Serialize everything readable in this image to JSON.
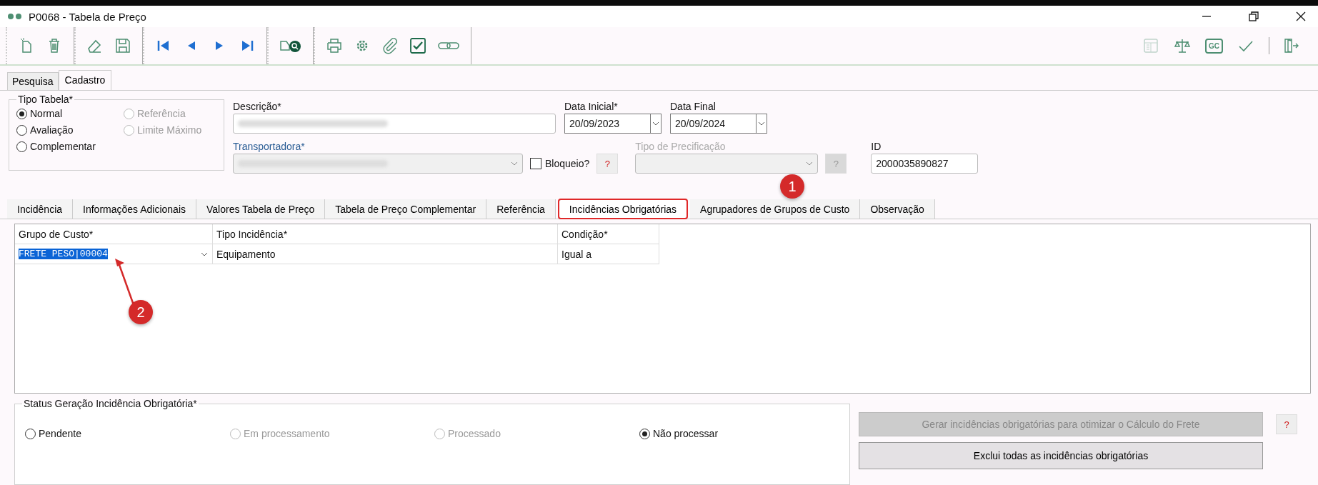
{
  "window": {
    "title": "P0068 - Tabela de Preço"
  },
  "toolbar": {
    "left_groups": [
      [
        {
          "kind": "new"
        },
        {
          "kind": "delete"
        }
      ],
      [
        {
          "kind": "edit"
        },
        {
          "kind": "save"
        }
      ],
      [
        {
          "kind": "first"
        },
        {
          "kind": "prev"
        },
        {
          "kind": "next"
        },
        {
          "kind": "last"
        }
      ],
      [
        {
          "kind": "search-truck"
        }
      ],
      [
        {
          "kind": "print"
        },
        {
          "kind": "gear"
        },
        {
          "kind": "clip"
        },
        {
          "kind": "check-box"
        },
        {
          "kind": "link"
        }
      ]
    ],
    "right": [
      {
        "kind": "sheet",
        "disabled": true
      },
      {
        "kind": "scale",
        "disabled": false
      },
      {
        "kind": "gc",
        "disabled": false
      },
      {
        "kind": "confirm",
        "disabled": false
      },
      {
        "kind": "exit",
        "disabled": false
      }
    ]
  },
  "gc_label": "GC",
  "main_tabs": [
    {
      "label": "Pesquisa",
      "selected": false
    },
    {
      "label": "Cadastro",
      "selected": true
    }
  ],
  "tipo_tabela": {
    "legend": "Tipo Tabela*",
    "options": [
      {
        "label": "Normal",
        "selected": true,
        "disabled": false
      },
      {
        "label": "Referência",
        "selected": false,
        "disabled": true
      },
      {
        "label": "Avaliação",
        "selected": false,
        "disabled": false
      },
      {
        "label": "Limite Máximo",
        "selected": false,
        "disabled": true
      },
      {
        "label": "Complementar",
        "selected": false,
        "disabled": false
      }
    ]
  },
  "descricao": {
    "label": "Descrição*",
    "redacted": true
  },
  "data_inicial": {
    "label": "Data Inicial*",
    "value": "20/09/2023"
  },
  "data_final": {
    "label": "Data Final",
    "value": "20/09/2024"
  },
  "transportadora": {
    "label": "Transportadora*",
    "redacted": true,
    "disabled": true
  },
  "bloqueio": {
    "label": "Bloqueio?",
    "checked": false
  },
  "help_1": {
    "label": "?",
    "disabled": false
  },
  "tipo_precificacao": {
    "label": "Tipo de Precificação",
    "disabled": true
  },
  "help_2": {
    "label": "?",
    "disabled": true
  },
  "id_field": {
    "label": "ID",
    "value": "2000035890827"
  },
  "sub_tabs": [
    {
      "label": "Incidência",
      "selected": false,
      "annotated": false
    },
    {
      "label": "Informações Adicionais",
      "selected": false,
      "annotated": false
    },
    {
      "label": "Valores Tabela de Preço",
      "selected": false,
      "annotated": false
    },
    {
      "label": "Tabela de Preço Complementar",
      "selected": false,
      "annotated": false
    },
    {
      "label": "Referência",
      "selected": false,
      "annotated": false
    },
    {
      "label": "Incidências Obrigatórias",
      "selected": true,
      "annotated": true
    },
    {
      "label": "Agrupadores de Grupos de Custo",
      "selected": false,
      "annotated": false
    },
    {
      "label": "Observação",
      "selected": false,
      "annotated": false
    }
  ],
  "table": {
    "columns": [
      "Grupo de Custo*",
      "Tipo Incidência*",
      "Condição*"
    ],
    "rows": [
      {
        "cells": [
          {
            "text": "FRETE PESO|00004",
            "selected": true
          },
          {
            "text": "Equipamento",
            "selected": false
          },
          {
            "text": "Igual a",
            "selected": false
          }
        ]
      }
    ]
  },
  "callouts": [
    "1",
    "2"
  ],
  "status": {
    "legend": "Status Geração Incidência Obrigatória*",
    "options": [
      {
        "label": "Pendente",
        "selected": false,
        "disabled": false
      },
      {
        "label": "Em processamento",
        "selected": false,
        "disabled": true
      },
      {
        "label": "Processado",
        "selected": false,
        "disabled": true
      },
      {
        "label": "Não processar",
        "selected": true,
        "disabled": false
      }
    ]
  },
  "actions": [
    {
      "label": "Gerar incidências obrigatórias para otimizar o Cálculo do Frete",
      "disabled": true,
      "help": "?"
    },
    {
      "label": "Exclui todas as incidências obrigatórias",
      "disabled": false
    }
  ]
}
